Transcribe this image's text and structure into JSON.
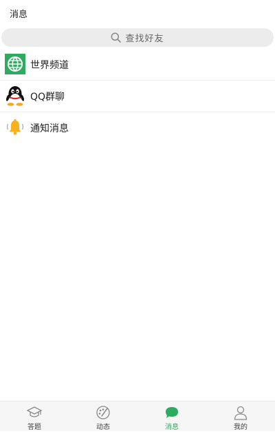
{
  "header": {
    "title": "消息"
  },
  "search": {
    "placeholder": "查找好友",
    "icon": "search-icon"
  },
  "list": {
    "items": [
      {
        "label": "世界频道",
        "icon": "globe-icon",
        "icon_bg": "#2dab5f"
      },
      {
        "label": "QQ群聊",
        "icon": "qq-penguin-icon"
      },
      {
        "label": "通知消息",
        "icon": "bell-icon",
        "icon_color": "#f5b21e"
      }
    ]
  },
  "tabbar": {
    "active_color": "#2dab5f",
    "tabs": [
      {
        "label": "答题",
        "icon": "graduation-cap-icon",
        "active": false
      },
      {
        "label": "动态",
        "icon": "palette-icon",
        "active": false
      },
      {
        "label": "消息",
        "icon": "chat-bubble-icon",
        "active": true
      },
      {
        "label": "我的",
        "icon": "user-icon",
        "active": false
      }
    ]
  }
}
